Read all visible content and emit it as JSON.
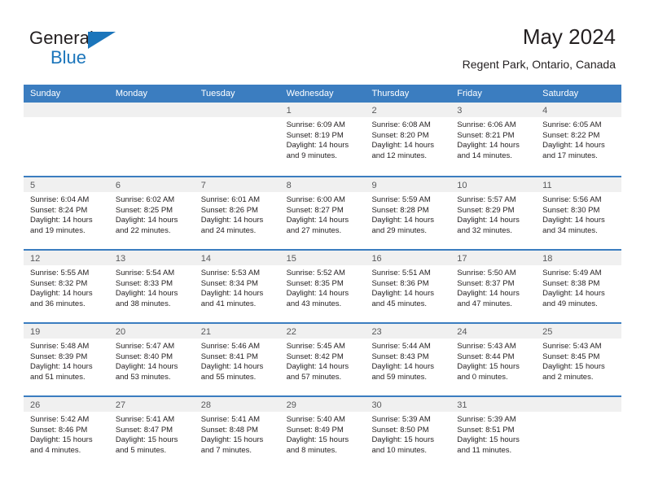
{
  "brand": {
    "name_top": "General",
    "name_bottom": "Blue",
    "triangle_color": "#1b75bb"
  },
  "header": {
    "title": "May 2024",
    "subtitle": "Regent Park, Ontario, Canada"
  },
  "theme": {
    "header_blue": "#3b7dc0",
    "band_gray": "#f0f0f0",
    "text_dark": "#231f20"
  },
  "weekdays": [
    "Sunday",
    "Monday",
    "Tuesday",
    "Wednesday",
    "Thursday",
    "Friday",
    "Saturday"
  ],
  "weeks": [
    [
      {
        "day": "",
        "empty": true
      },
      {
        "day": "",
        "empty": true
      },
      {
        "day": "",
        "empty": true
      },
      {
        "day": "1",
        "sunrise": "Sunrise: 6:09 AM",
        "sunset": "Sunset: 8:19 PM",
        "daylight1": "Daylight: 14 hours",
        "daylight2": "and 9 minutes."
      },
      {
        "day": "2",
        "sunrise": "Sunrise: 6:08 AM",
        "sunset": "Sunset: 8:20 PM",
        "daylight1": "Daylight: 14 hours",
        "daylight2": "and 12 minutes."
      },
      {
        "day": "3",
        "sunrise": "Sunrise: 6:06 AM",
        "sunset": "Sunset: 8:21 PM",
        "daylight1": "Daylight: 14 hours",
        "daylight2": "and 14 minutes."
      },
      {
        "day": "4",
        "sunrise": "Sunrise: 6:05 AM",
        "sunset": "Sunset: 8:22 PM",
        "daylight1": "Daylight: 14 hours",
        "daylight2": "and 17 minutes."
      }
    ],
    [
      {
        "day": "5",
        "sunrise": "Sunrise: 6:04 AM",
        "sunset": "Sunset: 8:24 PM",
        "daylight1": "Daylight: 14 hours",
        "daylight2": "and 19 minutes."
      },
      {
        "day": "6",
        "sunrise": "Sunrise: 6:02 AM",
        "sunset": "Sunset: 8:25 PM",
        "daylight1": "Daylight: 14 hours",
        "daylight2": "and 22 minutes."
      },
      {
        "day": "7",
        "sunrise": "Sunrise: 6:01 AM",
        "sunset": "Sunset: 8:26 PM",
        "daylight1": "Daylight: 14 hours",
        "daylight2": "and 24 minutes."
      },
      {
        "day": "8",
        "sunrise": "Sunrise: 6:00 AM",
        "sunset": "Sunset: 8:27 PM",
        "daylight1": "Daylight: 14 hours",
        "daylight2": "and 27 minutes."
      },
      {
        "day": "9",
        "sunrise": "Sunrise: 5:59 AM",
        "sunset": "Sunset: 8:28 PM",
        "daylight1": "Daylight: 14 hours",
        "daylight2": "and 29 minutes."
      },
      {
        "day": "10",
        "sunrise": "Sunrise: 5:57 AM",
        "sunset": "Sunset: 8:29 PM",
        "daylight1": "Daylight: 14 hours",
        "daylight2": "and 32 minutes."
      },
      {
        "day": "11",
        "sunrise": "Sunrise: 5:56 AM",
        "sunset": "Sunset: 8:30 PM",
        "daylight1": "Daylight: 14 hours",
        "daylight2": "and 34 minutes."
      }
    ],
    [
      {
        "day": "12",
        "sunrise": "Sunrise: 5:55 AM",
        "sunset": "Sunset: 8:32 PM",
        "daylight1": "Daylight: 14 hours",
        "daylight2": "and 36 minutes."
      },
      {
        "day": "13",
        "sunrise": "Sunrise: 5:54 AM",
        "sunset": "Sunset: 8:33 PM",
        "daylight1": "Daylight: 14 hours",
        "daylight2": "and 38 minutes."
      },
      {
        "day": "14",
        "sunrise": "Sunrise: 5:53 AM",
        "sunset": "Sunset: 8:34 PM",
        "daylight1": "Daylight: 14 hours",
        "daylight2": "and 41 minutes."
      },
      {
        "day": "15",
        "sunrise": "Sunrise: 5:52 AM",
        "sunset": "Sunset: 8:35 PM",
        "daylight1": "Daylight: 14 hours",
        "daylight2": "and 43 minutes."
      },
      {
        "day": "16",
        "sunrise": "Sunrise: 5:51 AM",
        "sunset": "Sunset: 8:36 PM",
        "daylight1": "Daylight: 14 hours",
        "daylight2": "and 45 minutes."
      },
      {
        "day": "17",
        "sunrise": "Sunrise: 5:50 AM",
        "sunset": "Sunset: 8:37 PM",
        "daylight1": "Daylight: 14 hours",
        "daylight2": "and 47 minutes."
      },
      {
        "day": "18",
        "sunrise": "Sunrise: 5:49 AM",
        "sunset": "Sunset: 8:38 PM",
        "daylight1": "Daylight: 14 hours",
        "daylight2": "and 49 minutes."
      }
    ],
    [
      {
        "day": "19",
        "sunrise": "Sunrise: 5:48 AM",
        "sunset": "Sunset: 8:39 PM",
        "daylight1": "Daylight: 14 hours",
        "daylight2": "and 51 minutes."
      },
      {
        "day": "20",
        "sunrise": "Sunrise: 5:47 AM",
        "sunset": "Sunset: 8:40 PM",
        "daylight1": "Daylight: 14 hours",
        "daylight2": "and 53 minutes."
      },
      {
        "day": "21",
        "sunrise": "Sunrise: 5:46 AM",
        "sunset": "Sunset: 8:41 PM",
        "daylight1": "Daylight: 14 hours",
        "daylight2": "and 55 minutes."
      },
      {
        "day": "22",
        "sunrise": "Sunrise: 5:45 AM",
        "sunset": "Sunset: 8:42 PM",
        "daylight1": "Daylight: 14 hours",
        "daylight2": "and 57 minutes."
      },
      {
        "day": "23",
        "sunrise": "Sunrise: 5:44 AM",
        "sunset": "Sunset: 8:43 PM",
        "daylight1": "Daylight: 14 hours",
        "daylight2": "and 59 minutes."
      },
      {
        "day": "24",
        "sunrise": "Sunrise: 5:43 AM",
        "sunset": "Sunset: 8:44 PM",
        "daylight1": "Daylight: 15 hours",
        "daylight2": "and 0 minutes."
      },
      {
        "day": "25",
        "sunrise": "Sunrise: 5:43 AM",
        "sunset": "Sunset: 8:45 PM",
        "daylight1": "Daylight: 15 hours",
        "daylight2": "and 2 minutes."
      }
    ],
    [
      {
        "day": "26",
        "sunrise": "Sunrise: 5:42 AM",
        "sunset": "Sunset: 8:46 PM",
        "daylight1": "Daylight: 15 hours",
        "daylight2": "and 4 minutes."
      },
      {
        "day": "27",
        "sunrise": "Sunrise: 5:41 AM",
        "sunset": "Sunset: 8:47 PM",
        "daylight1": "Daylight: 15 hours",
        "daylight2": "and 5 minutes."
      },
      {
        "day": "28",
        "sunrise": "Sunrise: 5:41 AM",
        "sunset": "Sunset: 8:48 PM",
        "daylight1": "Daylight: 15 hours",
        "daylight2": "and 7 minutes."
      },
      {
        "day": "29",
        "sunrise": "Sunrise: 5:40 AM",
        "sunset": "Sunset: 8:49 PM",
        "daylight1": "Daylight: 15 hours",
        "daylight2": "and 8 minutes."
      },
      {
        "day": "30",
        "sunrise": "Sunrise: 5:39 AM",
        "sunset": "Sunset: 8:50 PM",
        "daylight1": "Daylight: 15 hours",
        "daylight2": "and 10 minutes."
      },
      {
        "day": "31",
        "sunrise": "Sunrise: 5:39 AM",
        "sunset": "Sunset: 8:51 PM",
        "daylight1": "Daylight: 15 hours",
        "daylight2": "and 11 minutes."
      },
      {
        "day": "",
        "empty": true
      }
    ]
  ]
}
